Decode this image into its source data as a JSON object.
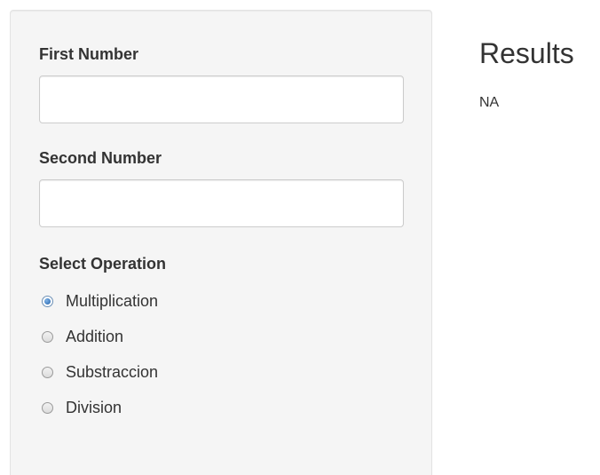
{
  "sidebar": {
    "first_number_label": "First Number",
    "first_number_value": "",
    "second_number_label": "Second Number",
    "second_number_value": "",
    "operation_label": "Select Operation",
    "operations": [
      {
        "label": "Multiplication",
        "checked": true
      },
      {
        "label": "Addition",
        "checked": false
      },
      {
        "label": "Substraccion",
        "checked": false
      },
      {
        "label": "Division",
        "checked": false
      }
    ]
  },
  "main": {
    "results_title": "Results",
    "results_value": "NA"
  },
  "colors": {
    "panel_background": "#f5f5f5",
    "panel_border": "#e3e3e3",
    "text": "#333333",
    "radio_selected": "#1f5fa8"
  },
  "icons": {
    "radio_selected": "radio-selected-icon",
    "radio_unselected": "radio-unselected-icon"
  }
}
